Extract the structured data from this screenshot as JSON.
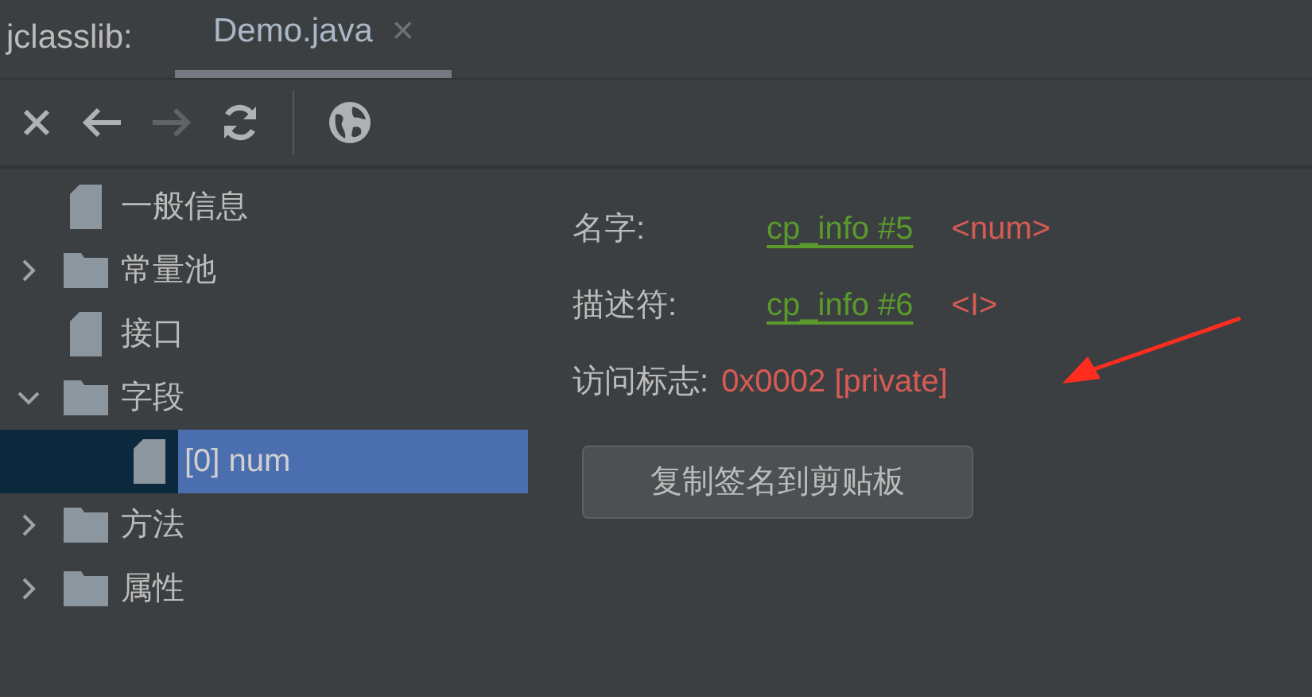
{
  "tab_bar": {
    "prefix": "jclasslib:",
    "tabs": [
      {
        "label": "Demo.java",
        "selected": true,
        "close": "×"
      }
    ]
  },
  "toolbar": {
    "buttons": [
      {
        "kind": "close",
        "disabled": false
      },
      {
        "kind": "back",
        "disabled": false
      },
      {
        "kind": "forward",
        "disabled": true
      },
      {
        "kind": "refresh",
        "disabled": false
      },
      {
        "kind": "separator"
      },
      {
        "kind": "web",
        "disabled": false
      }
    ]
  },
  "tree": {
    "items": [
      {
        "label": "一般信息",
        "kind": "file",
        "selected": false
      },
      {
        "label": "常量池",
        "kind": "folder",
        "expanded": false,
        "selected": false
      },
      {
        "label": "接口",
        "kind": "file",
        "selected": false
      },
      {
        "label": "字段",
        "kind": "folder",
        "expanded": true,
        "selected": false,
        "children": [
          {
            "label": "[0] num",
            "kind": "file",
            "selected": true
          }
        ]
      },
      {
        "label": "方法",
        "kind": "folder",
        "expanded": false,
        "selected": false
      },
      {
        "label": "属性",
        "kind": "folder",
        "expanded": false,
        "selected": false
      }
    ]
  },
  "details": {
    "rows": [
      {
        "label": "名字:",
        "kind": "link",
        "link": "cp_info #5",
        "value": "<num>"
      },
      {
        "label": "描述符:",
        "kind": "link",
        "link": "cp_info #6",
        "value": "<I>"
      },
      {
        "label": "访问标志:",
        "kind": "text",
        "value": "0x0002 [private]"
      }
    ],
    "button": "复制签名到剪贴板"
  },
  "annotation": {
    "kind": "arrow",
    "color": "#ff2d20"
  }
}
